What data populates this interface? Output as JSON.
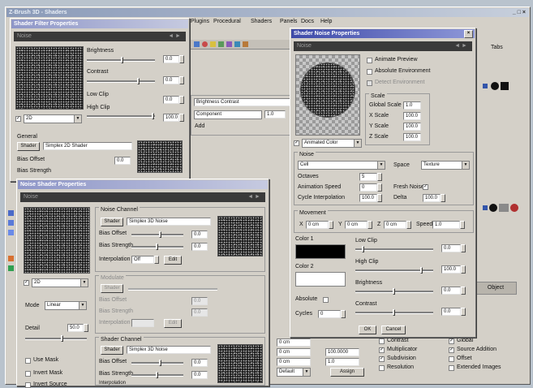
{
  "main_window": {
    "title": "Z-Brush 3D - Shaders",
    "menu": [
      "Plugins",
      "Procedural",
      "Shaders",
      "Panels",
      "Docs",
      "Help"
    ],
    "tabs_right": "Tabs",
    "effect_panel": {
      "search_value": "Brightness Contrast",
      "combo_value": "Component",
      "label": "Add"
    }
  },
  "win_back": {
    "title": "Shader Filter Properties",
    "header": "Noise",
    "labels": {
      "brightness": "Brightness",
      "contrast": "Contrast",
      "low_clip": "Low Clip",
      "high_clip": "High Clip"
    },
    "values": {
      "brightness": "0.0",
      "contrast": "0.0",
      "low_clip": "0.0",
      "high_clip": "100.0"
    },
    "mode_select": "2D",
    "section": "General",
    "shader_btn": "Shader",
    "shader_name": "Simplex 2D Shader",
    "bias_offset": {
      "label": "Bias Offset",
      "value": "0.0"
    },
    "bias_strength": {
      "label": "Bias Strength",
      "value": "0.0"
    }
  },
  "win_front": {
    "title": "Noise Shader Properties",
    "header": "Noise",
    "mode_select": "2D",
    "mode_label": "Mode",
    "mode_value": "Linear",
    "detail_label": "Detail",
    "detail_value": "50.0",
    "checkboxes": [
      "Use Mask",
      "Invert Mask",
      "Invert Source"
    ],
    "group1": {
      "title": "Noise Channel",
      "shader_btn": "Shader",
      "shader_name": "Simplex 3D Noise",
      "bias_offset_label": "Bias Offset",
      "bias_offset_value": "0.0",
      "bias_strength_label": "Bias Strength",
      "bias_strength_value": "0.0",
      "interp_label": "Interpolation",
      "interp_value": "Off",
      "edit_label": "Edit"
    },
    "group2": {
      "title": "Modulate",
      "shader_btn": "Shader",
      "rows": [
        "Bias Offset",
        "Bias Strength",
        "Interpolation"
      ],
      "values": [
        "0.0",
        "0.0",
        ""
      ],
      "edit_label": "Edit"
    },
    "group3": {
      "title": "Shader Channel",
      "shader_btn": "Shader",
      "shader_name": "Simplex 3D Noise",
      "bias_offset_label": "Bias Offset",
      "bias_offset_value": "0.0",
      "bias_strength_label": "Bias Strength",
      "bias_strength_value": "0.0",
      "interp_label": "Interpolation",
      "edit_label": "Edit"
    }
  },
  "win_noise": {
    "title": "Shader Noise Properties",
    "header": "Noise",
    "checkboxes": [
      {
        "label": "Animate Preview",
        "checked": false,
        "disabled": false
      },
      {
        "label": "Absolute Environment",
        "checked": false,
        "disabled": false
      },
      {
        "label": "Detect Environment",
        "checked": false,
        "disabled": true
      }
    ],
    "scale_group": {
      "title": "Scale",
      "rows": [
        {
          "label": "Global Scale",
          "value": "1.0"
        },
        {
          "label": "X Scale",
          "value": "100.0"
        },
        {
          "label": "Y Scale",
          "value": "100.0"
        },
        {
          "label": "Z Scale",
          "value": "100.0"
        }
      ]
    },
    "preview_select": "Animated Color",
    "noise_section": {
      "title": "Noise",
      "type_value": "Cell",
      "space_label": "Space",
      "space_value": "Texture",
      "octaves_label": "Octaves",
      "octaves_value": "5",
      "anim_speed_label": "Animation Speed",
      "anim_speed_value": "0",
      "fresh_label": "Fresh Noise",
      "cycle_label": "Cycle Interpolation",
      "cycle_value": "100.0",
      "delta_label": "Delta",
      "delta_value": "100.0"
    },
    "movement": {
      "title": "Movement",
      "x_label": "X",
      "x_value": "0 cm",
      "y_label": "Y",
      "y_value": "0 cm",
      "z_label": "Z",
      "z_value": "0 cm",
      "speed_label": "Speed",
      "speed_value": "1.0"
    },
    "color1": "Color 1",
    "color2": "Color 2",
    "absolute_label": "Absolute",
    "cycles_label": "Cycles",
    "cycles_value": "0",
    "right_sliders": [
      {
        "label": "Low Clip",
        "value": "0.0"
      },
      {
        "label": "High Clip",
        "value": "100.0"
      },
      {
        "label": "Brightness",
        "value": "0.0"
      },
      {
        "label": "Contrast",
        "value": "0.0"
      }
    ],
    "ok_label": "OK",
    "cancel_label": "Cancel"
  },
  "bottom_panel": {
    "fields": [
      "0 cm",
      "0 cm",
      "0 cm",
      "Default"
    ],
    "fields_right": [
      "100.0000",
      "1.0"
    ],
    "button": "Assign",
    "checks": [
      {
        "label": "Contrast",
        "checked": false
      },
      {
        "label": "Multiplicator",
        "checked": true
      },
      {
        "label": "Subdivision",
        "checked": true
      },
      {
        "label": "Resolution",
        "checked": false
      },
      {
        "label": "Global",
        "checked": true
      },
      {
        "label": "Source Addition",
        "checked": true
      },
      {
        "label": "Offset",
        "checked": false
      },
      {
        "label": "Extended Images",
        "checked": false
      }
    ],
    "tab_label": "Object"
  }
}
